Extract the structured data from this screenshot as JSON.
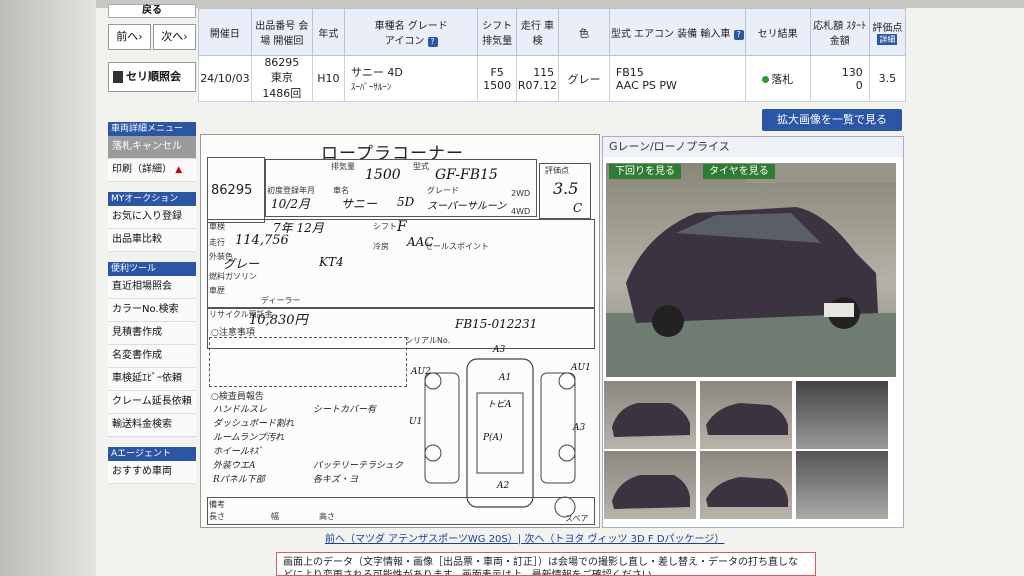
{
  "sidebar": {
    "top_label": "戻る",
    "prev_label": "前へ",
    "next_label": "次へ",
    "seri_label": "セリ順照会",
    "section_detail": "車両詳細メニュー",
    "cancel_label": "落札キャンセル",
    "print_label": "印刷（詳細）",
    "section_my": "MYオークション",
    "favorite_label": "お気に入り登録",
    "exhibit_label": "出品車比較",
    "section_tools": "便利ツール",
    "recent_label": "直近相場照会",
    "color_label": "カラーNo.検索",
    "estimate_label": "見積書作成",
    "name_change_label": "名変書作成",
    "inspection_label": "車検延ｴﾋﾟｰ依頼",
    "claim_label": "クレーム延長依頼",
    "shipping_label": "輸送料金検索",
    "section_agent": "Aエージェント",
    "agent_label": "おすすめ車両"
  },
  "table": {
    "headers": {
      "date": "開催日",
      "exhibit": "出品番号 会 場 開催回",
      "year": "年式",
      "model": "車種名 グレード",
      "icon": "アイコン",
      "shift": "シフト 排気量",
      "mileage": "走行 車検",
      "color": "色",
      "type": "型式 エアコン 装備",
      "import": "輸入車",
      "result": "セリ結果",
      "bid": "応札額 ｽﾀｰﾄ金額",
      "score": "評価点",
      "detail": "詳細"
    },
    "row": {
      "date": "24/10/03",
      "exhibit_no": "86295",
      "venue": "東京",
      "session": "1486回",
      "year": "H10",
      "model": "サニー 4D",
      "grade": "ｽｰﾊﾟｰｻﾙｰﾝ",
      "shift": "F5",
      "displacement": "1500",
      "mileage": "115",
      "inspection": "R07.12",
      "color": "グレー",
      "type_code": "FB15",
      "equipment": "AAC PS PW",
      "result": "落札",
      "bid": "130",
      "start": "0",
      "score": "3.5"
    }
  },
  "enlarge_button": "拡大画像を一覧で見る",
  "sheet": {
    "title": "ロープラコーナー",
    "exhibit_no": "86295",
    "displacement_label": "排気量",
    "displacement": "1500",
    "type_label": "型式",
    "type_code": "GF-FB15",
    "score_label": "評価点",
    "score": "3.5",
    "interior": "C",
    "first_reg_label": "初度登録年月",
    "first_reg": "10/2月",
    "car_label": "車名",
    "car_name": "サニー",
    "doors": "5D",
    "grade_label": "グレード",
    "grade": "スーパーサルーン",
    "drive_2wd": "2WD",
    "drive_4wd": "4WD",
    "inspection_label": "車検",
    "inspection": "7年 12月",
    "shift_label": "シフト",
    "shift": "F",
    "mileage_label": "走行",
    "mileage": "114,756",
    "ac_label": "冷房",
    "ac": "AAC",
    "color_label": "外装色",
    "color": "グレー",
    "color_code": "KT4",
    "fuel_label": "燃料",
    "fuel": "ガソリン",
    "history_label": "車歴",
    "history": "ディーラー",
    "recycle_label": "リサイクル預託金",
    "recycle": "10,830円",
    "sales_point_label": "セールスポイント",
    "plate": "FB15-012231",
    "vin_label": "シリアルNo.",
    "caution_label": "○注意事項",
    "report_label": "○検査員報告",
    "notes": [
      "ハンドルスレ",
      "ダッシュボード割れ",
      "ルームランプ汚れ",
      "ホイールｷｽﾞ",
      "外装ウエA",
      "Rパネル下部",
      "シートカバー有",
      "パッテリーテラシュク",
      "各キズ・ヨ"
    ],
    "map_marks": [
      "A3",
      "A1",
      "AU2",
      "AU1",
      "U1",
      "A3",
      "A2",
      "P(A)",
      "トビA"
    ],
    "bottom_labels": [
      "備考",
      "長さ",
      "幅",
      "高さ",
      "スペア"
    ]
  },
  "photos": {
    "title": "Gレーン/ローノプライス",
    "btn_under": "下回りを見る",
    "btn_tire": "タイヤを見る"
  },
  "nav_links": "前へ（マツダ アテンザスポーツWG 20S）| 次へ（トヨタ ヴィッツ 3D F Dパッケージ）",
  "disclaimer": "画面上のデータ（文字情報・画像［出品票・車両・訂正］）は会場での撮影し直し・差し替え・データの打ち直しな どにより変更される可能性があります。画面表示は上、最新情報をご確認ください。"
}
